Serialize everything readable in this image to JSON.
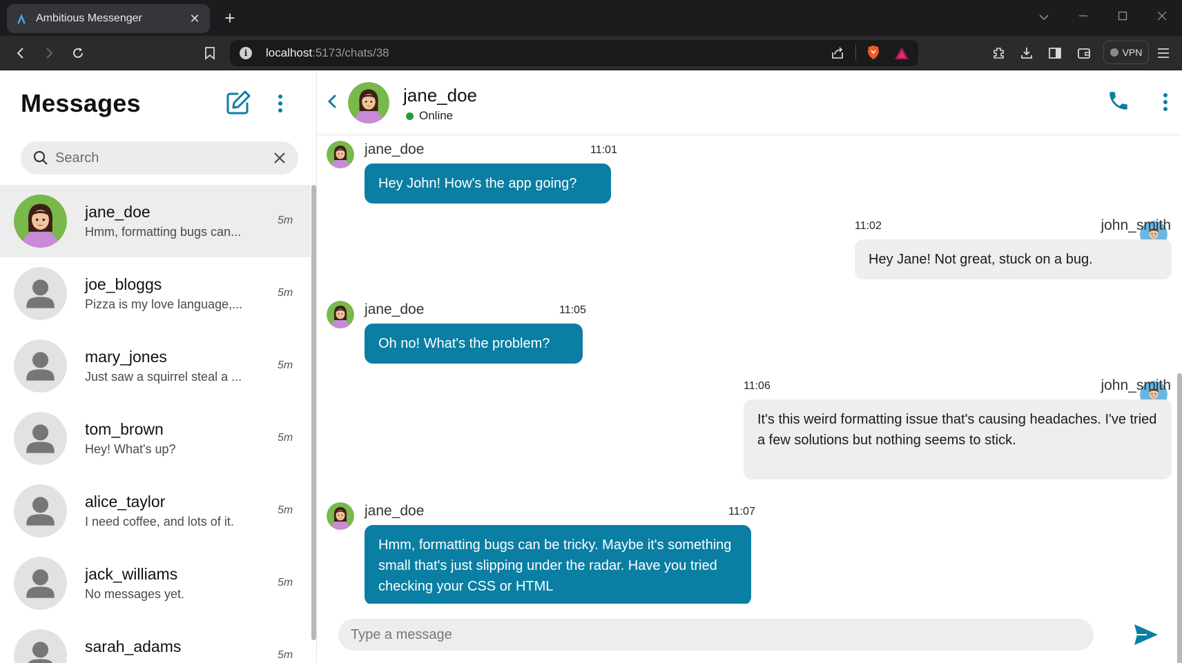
{
  "browser": {
    "tab_title": "Ambitious Messenger",
    "url_host": "localhost",
    "url_rest": ":5173/chats/38",
    "vpn_label": "VPN"
  },
  "sidebar": {
    "title": "Messages",
    "search_placeholder": "Search",
    "chats": [
      {
        "name": "jane_doe",
        "preview": "Hmm, formatting bugs can...",
        "time": "5m",
        "avatar": "jane",
        "active": true
      },
      {
        "name": "joe_bloggs",
        "preview": "Pizza is my love language,...",
        "time": "5m",
        "avatar": "default"
      },
      {
        "name": "mary_jones",
        "preview": "Just saw a squirrel steal a ...",
        "time": "5m",
        "avatar": "default"
      },
      {
        "name": "tom_brown",
        "preview": "Hey! What's up?",
        "time": "5m",
        "avatar": "default"
      },
      {
        "name": "alice_taylor",
        "preview": "I need coffee, and lots of it.",
        "time": "5m",
        "avatar": "default"
      },
      {
        "name": "jack_williams",
        "preview": "No messages yet.",
        "time": "5m",
        "avatar": "default"
      },
      {
        "name": "sarah_adams",
        "preview": "",
        "time": "5m",
        "avatar": "default"
      }
    ]
  },
  "chat": {
    "contact_name": "jane_doe",
    "status": "Online",
    "messages": [
      {
        "sender": "jane_doe",
        "time": "11:01",
        "direction": "in",
        "text": "Hey John! How's the app going?"
      },
      {
        "sender": "john_smith",
        "time": "11:02",
        "direction": "out",
        "text": "Hey Jane! Not great, stuck on a bug."
      },
      {
        "sender": "jane_doe",
        "time": "11:05",
        "direction": "in",
        "text": "Oh no! What's the problem?"
      },
      {
        "sender": "john_smith",
        "time": "11:06",
        "direction": "out",
        "text": "It's this weird formatting issue that's causing headaches. I've tried a few solutions but nothing seems to stick."
      },
      {
        "sender": "jane_doe",
        "time": "11:07",
        "direction": "in",
        "text": "Hmm, formatting bugs can be tricky. Maybe it's something small that's just slipping under the radar. Have you tried checking your CSS or HTML"
      }
    ],
    "composer_placeholder": "Type a message"
  },
  "colors": {
    "accent": "#0a7ea3",
    "incoming_bubble": "#0a7ea3",
    "outgoing_bubble": "#eeeeee",
    "online": "#1e9e3a"
  }
}
